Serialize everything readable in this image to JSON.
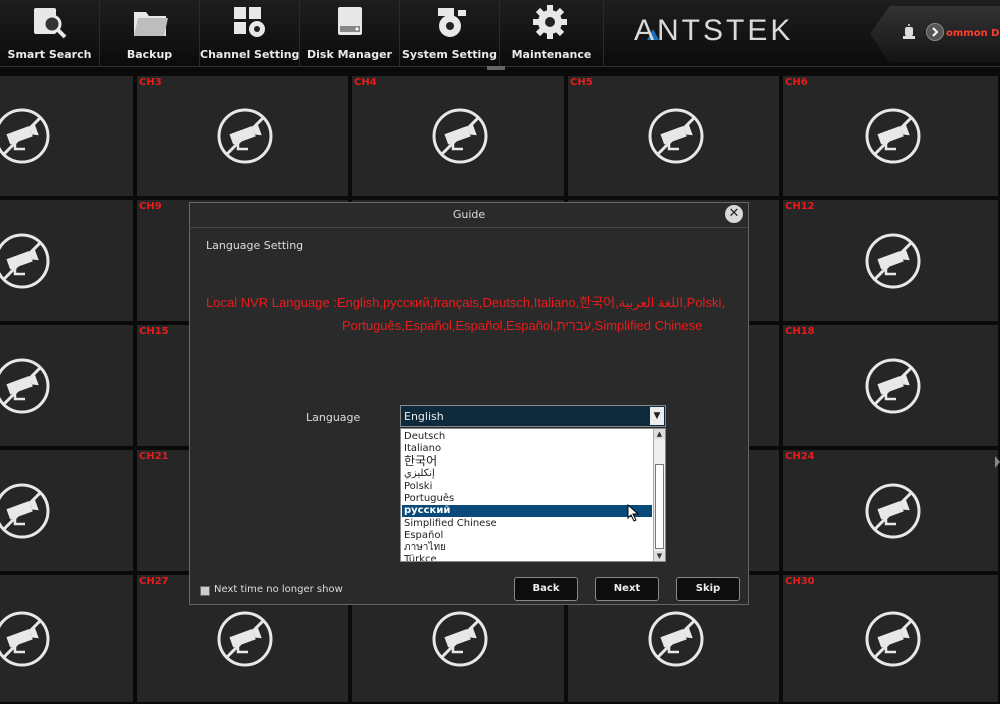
{
  "toolbar": {
    "items": [
      {
        "label": "Smart Search",
        "icon": "smart-search-icon"
      },
      {
        "label": "Backup",
        "icon": "folder-icon"
      },
      {
        "label": "Channel Setting",
        "icon": "channel-setting-icon"
      },
      {
        "label": "Disk Manager",
        "icon": "disk-icon"
      },
      {
        "label": "System Setting",
        "icon": "system-setting-icon"
      },
      {
        "label": "Maintenance",
        "icon": "gear-icon"
      }
    ],
    "brand": "ANTSTEK",
    "user": "ommon Di"
  },
  "grid": {
    "labels": [
      "",
      "CH3",
      "CH4",
      "CH5",
      "CH6",
      "",
      "CH9",
      "",
      "",
      "CH12",
      "",
      "CH15",
      "",
      "",
      "CH18",
      "",
      "CH21",
      "",
      "",
      "CH24",
      "",
      "CH27",
      "",
      "",
      "CH30"
    ]
  },
  "dialog": {
    "title": "Guide",
    "section": "Language Setting",
    "info_line1": "Local NVR Language :English,русский,français,Deutsch,Italiano,한국어,اللغة العربية,Polski,",
    "info_line2": "Português,Español,Español,Español,עברית,Simplified Chinese",
    "language_label": "Language",
    "selected_language": "English",
    "options": [
      {
        "label": "Deutsch"
      },
      {
        "label": "Italiano"
      },
      {
        "label": "한국어"
      },
      {
        "label": "إنكليزي"
      },
      {
        "label": "Polski"
      },
      {
        "label": "Português"
      },
      {
        "label": "русский"
      },
      {
        "label": "Simplified Chinese"
      },
      {
        "label": "Español"
      },
      {
        "label": "ภาษาไทย"
      },
      {
        "label": "Türkçe"
      }
    ],
    "highlighted_option": "русский",
    "checkbox_label": "Next time no longer show",
    "buttons": {
      "back": "Back",
      "next": "Next",
      "skip": "Skip"
    },
    "close_symbol": "✕"
  },
  "colors": {
    "accent_red": "#ea1c1c",
    "selection_blue": "#0a4a7a",
    "brand_blue": "#1b72c4"
  }
}
